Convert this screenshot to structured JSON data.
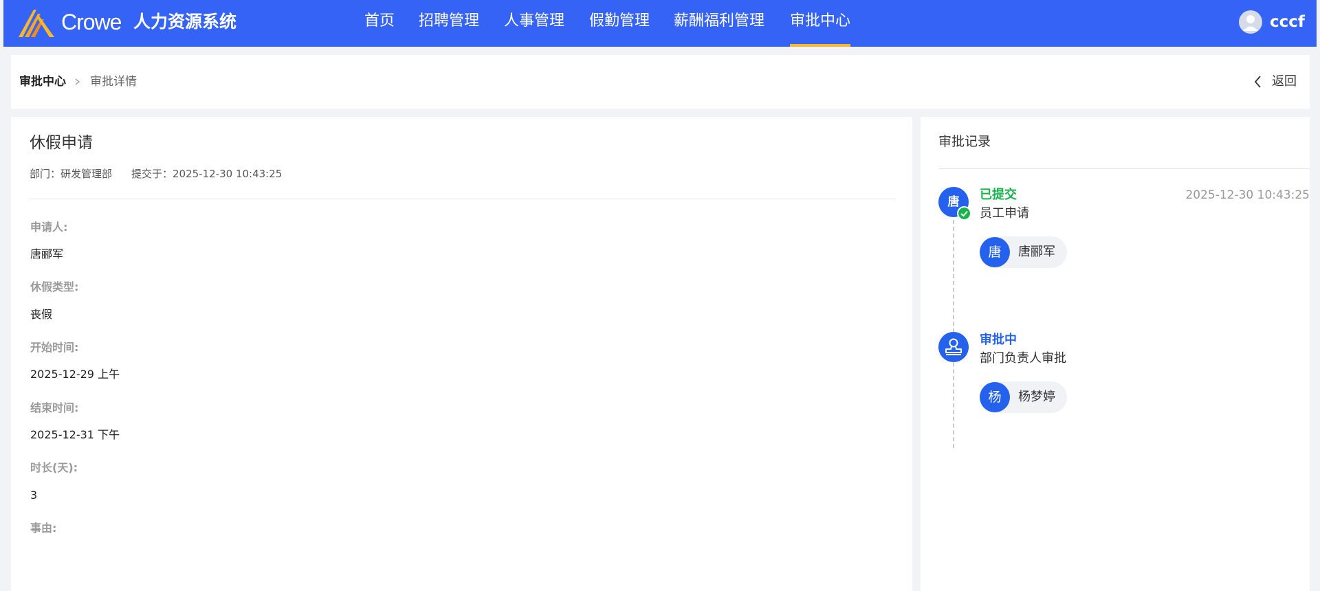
{
  "header": {
    "brand_en": "Crowe",
    "brand_cn": "人力资源系统",
    "nav": [
      {
        "label": "首页"
      },
      {
        "label": "招聘管理"
      },
      {
        "label": "人事管理"
      },
      {
        "label": "假勤管理"
      },
      {
        "label": "薪酬福利管理"
      },
      {
        "label": "审批中心",
        "active": true
      }
    ],
    "user_name": "cccf",
    "colors": {
      "bar": "#3563f5",
      "active_underline": "#f5b82e"
    }
  },
  "breadcrumb": {
    "root": "审批中心",
    "current": "审批详情",
    "back_label": "返回"
  },
  "detail": {
    "title": "休假申请",
    "department": "部门：研发管理部",
    "submitted": "提交于：2025-12-30 10:43:25",
    "fields": [
      {
        "label": "申请人:",
        "value": "唐郦军"
      },
      {
        "label": "休假类型:",
        "value": "丧假"
      },
      {
        "label": "开始时间:",
        "value": "2025-12-29 上午"
      },
      {
        "label": "结束时间:",
        "value": "2025-12-31 下午"
      },
      {
        "label": "时长(天):",
        "value": "3"
      },
      {
        "label": "事由:",
        "value": ""
      }
    ]
  },
  "record": {
    "title": "审批记录",
    "steps": [
      {
        "node_text": "唐",
        "status": "已提交",
        "status_color": "#19b34b",
        "desc": "员工申请",
        "time": "2025-12-30 10:43:25",
        "person_avatar": "唐",
        "person_name": "唐郦军"
      },
      {
        "node_icon": "stamp-icon",
        "status": "审批中",
        "status_color": "#2462ee",
        "desc": "部门负责人审批",
        "time": "",
        "person_avatar": "杨",
        "person_name": "杨梦婷"
      }
    ]
  }
}
